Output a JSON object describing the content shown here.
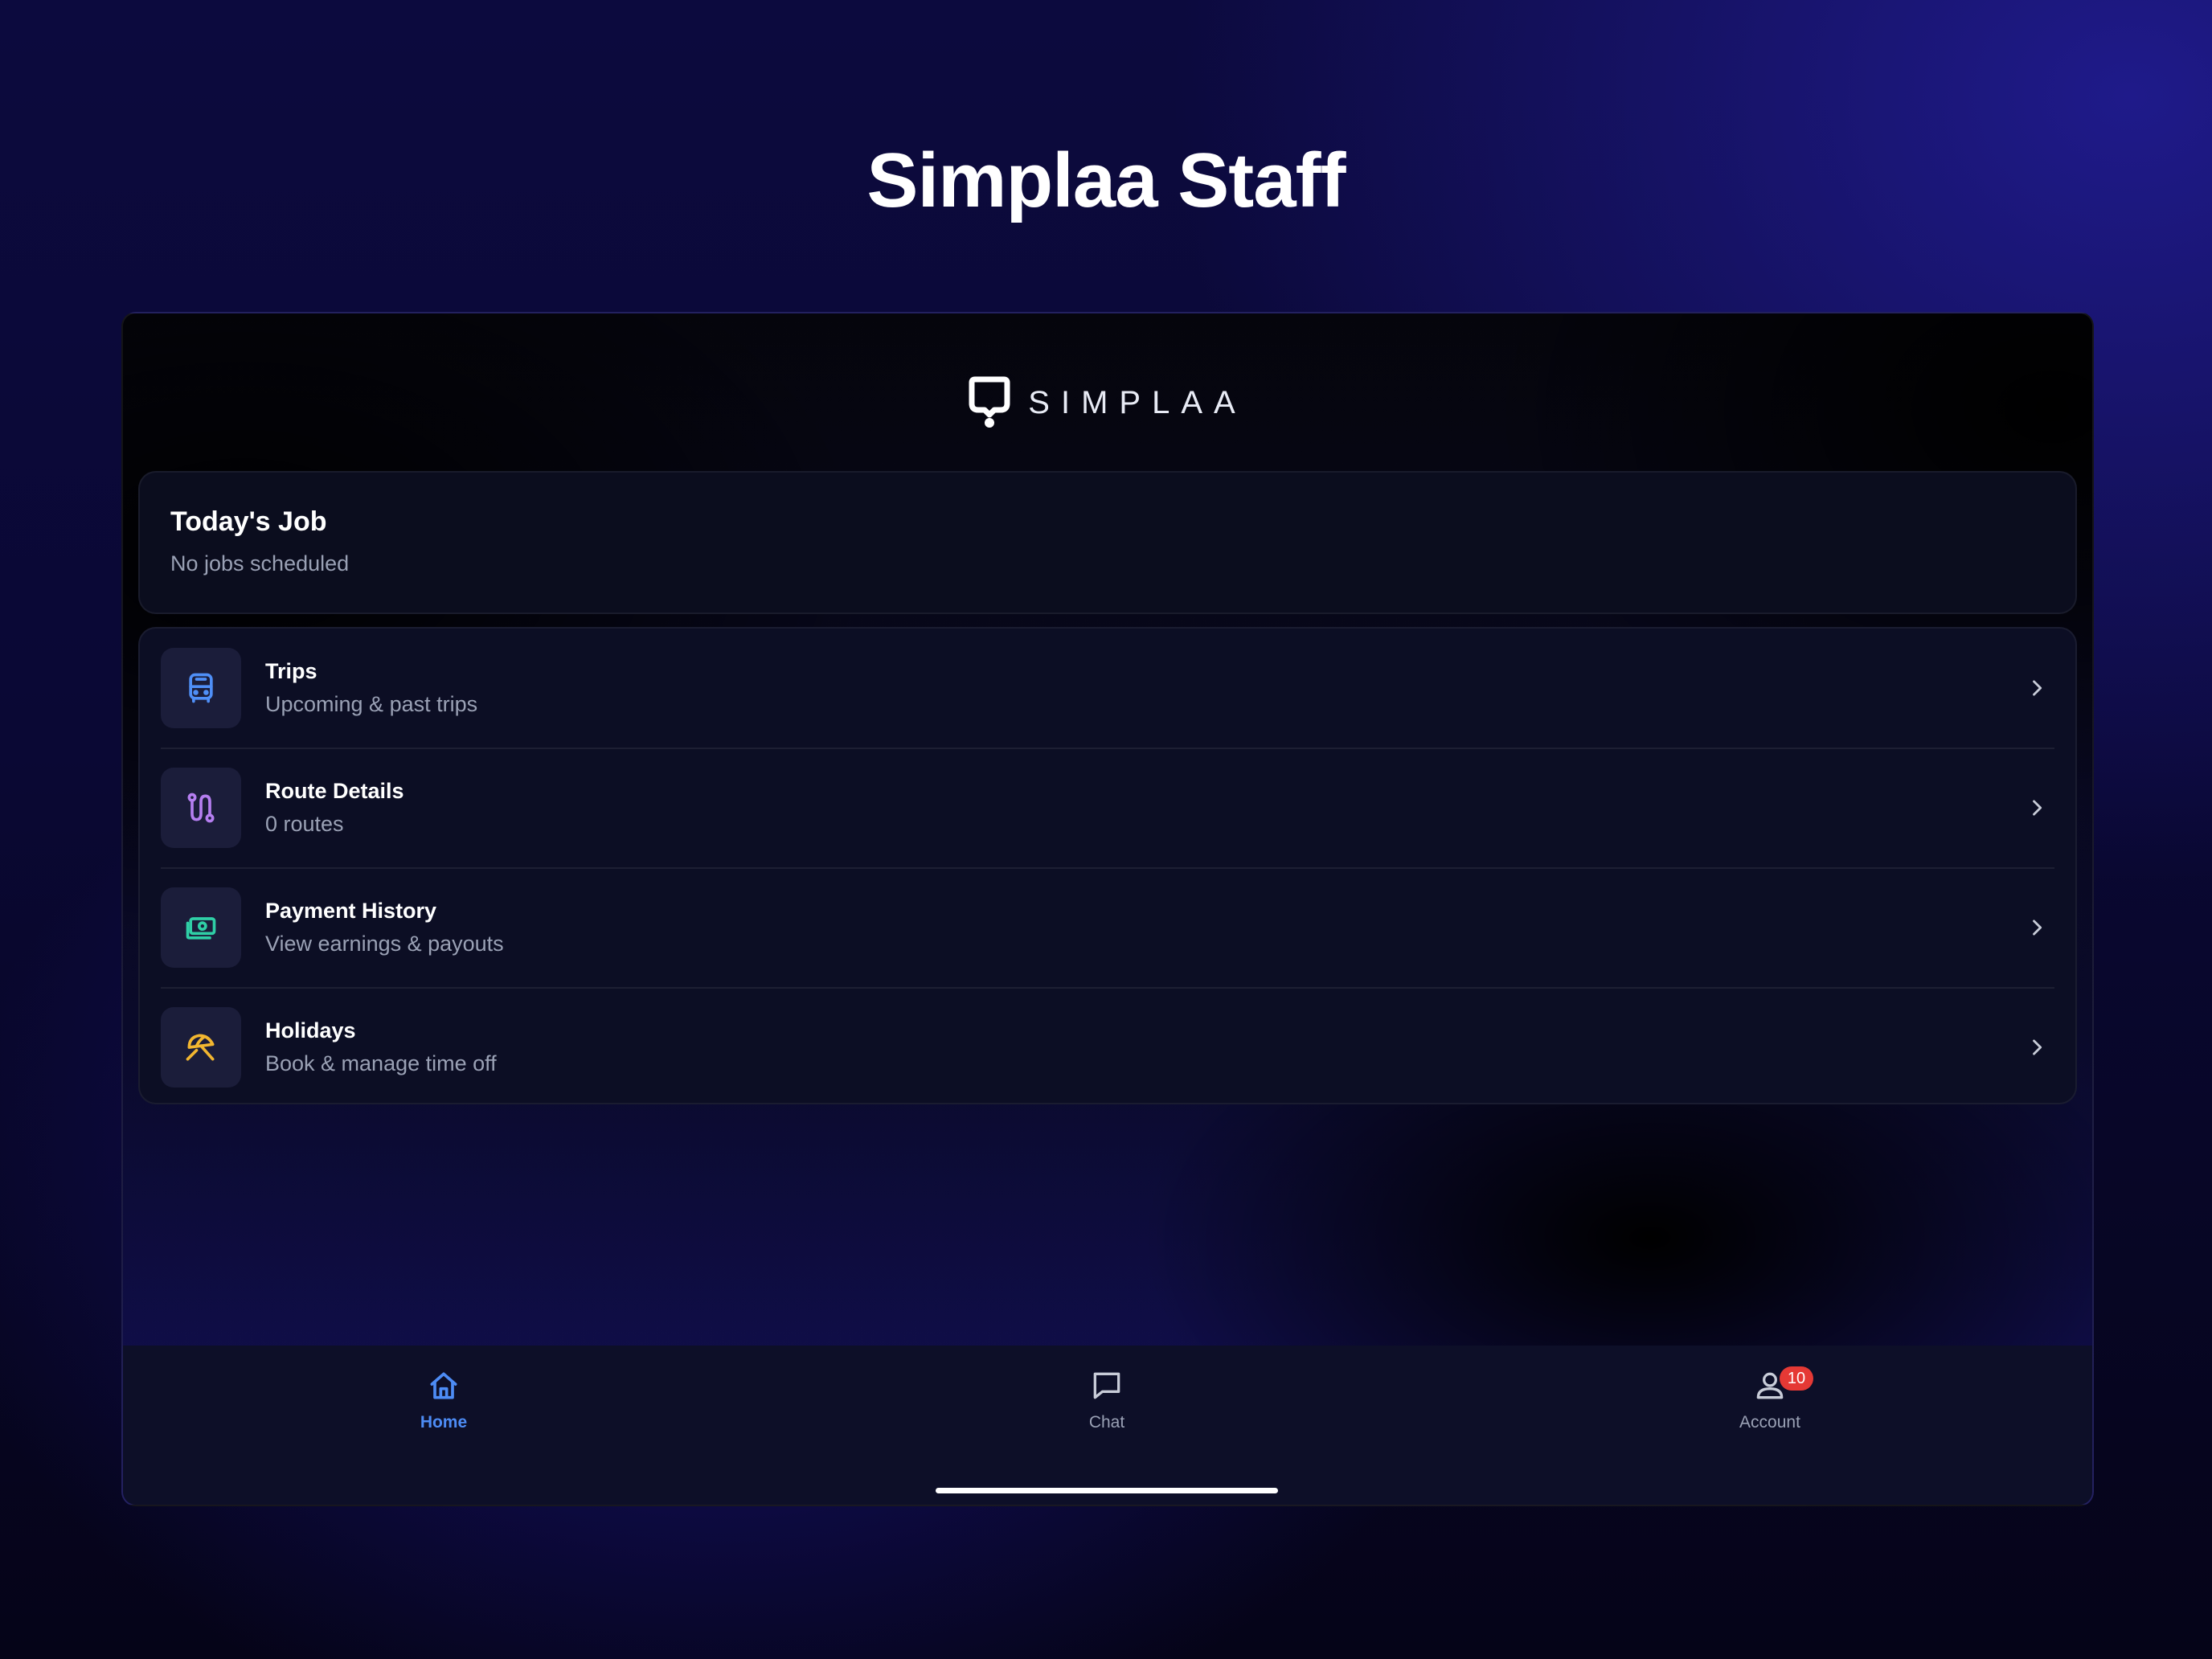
{
  "hero": {
    "title": "Simplaa Staff"
  },
  "app": {
    "logo_text": "SIMPLAA",
    "today_job": {
      "title": "Today's Job",
      "subtitle": "No jobs scheduled"
    },
    "menu": [
      {
        "title": "Trips",
        "subtitle": "Upcoming & past trips",
        "icon": "bus-icon",
        "color": "#4f8ff7"
      },
      {
        "title": "Route Details",
        "subtitle": "0 routes",
        "icon": "route-icon",
        "color": "#b57ef0"
      },
      {
        "title": "Payment History",
        "subtitle": "View earnings & payouts",
        "icon": "money-icon",
        "color": "#2fcfa6"
      },
      {
        "title": "Holidays",
        "subtitle": "Book & manage time off",
        "icon": "beach-umbrella-icon",
        "color": "#f2b630"
      }
    ],
    "tabs": [
      {
        "label": "Home",
        "icon": "home-icon",
        "active": true
      },
      {
        "label": "Chat",
        "icon": "chat-icon",
        "active": false
      },
      {
        "label": "Account",
        "icon": "account-icon",
        "active": false,
        "badge": "10"
      }
    ],
    "colors": {
      "accent": "#4d8cf5",
      "badge": "#e53935"
    }
  }
}
